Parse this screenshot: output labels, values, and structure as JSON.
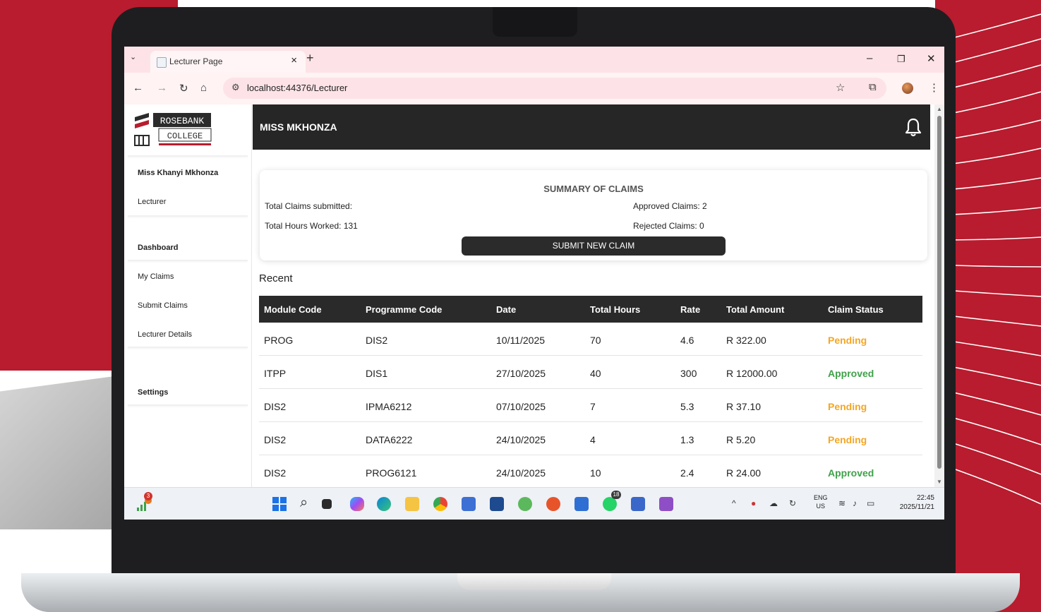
{
  "browser": {
    "tab_title": "Lecturer Page",
    "url": "localhost:44376/Lecturer"
  },
  "logo": {
    "line1": "ROSEBANK",
    "line2": "COLLEGE",
    "mark": "IIE"
  },
  "sidebar": {
    "user_name": "Miss Khanyi Mkhonza",
    "role": "Lecturer",
    "items": [
      {
        "label": "Dashboard"
      },
      {
        "label": "My Claims"
      },
      {
        "label": "Submit Claims"
      },
      {
        "label": "Lecturer Details"
      },
      {
        "label": "Settings"
      }
    ]
  },
  "header": {
    "title": "MISS MKHONZA"
  },
  "summary": {
    "title": "SUMMARY OF CLAIMS",
    "total_claims": "Total Claims submitted:",
    "total_hours": "Total Hours Worked: 131",
    "approved": "Approved Claims: 2",
    "rejected": "Rejected Claims: 0",
    "button": "SUBMIT NEW CLAIM"
  },
  "recent": {
    "heading": "Recent",
    "columns": [
      "Module Code",
      "Programme Code",
      "Date",
      "Total Hours",
      "Rate",
      "Total Amount",
      "Claim Status"
    ],
    "rows": [
      [
        "PROG",
        "DIS2",
        "10/11/2025",
        "70",
        "4.6",
        "R 322.00",
        "Pending"
      ],
      [
        "ITPP",
        "DIS1",
        "27/10/2025",
        "40",
        "300",
        "R 12000.00",
        "Approved"
      ],
      [
        "DIS2",
        "IPMA6212",
        "07/10/2025",
        "7",
        "5.3",
        "R 37.10",
        "Pending"
      ],
      [
        "DIS2",
        "DATA6222",
        "24/10/2025",
        "4",
        "1.3",
        "R 5.20",
        "Pending"
      ],
      [
        "DIS2",
        "PROG6121",
        "24/10/2025",
        "10",
        "2.4",
        "R 24.00",
        "Approved"
      ]
    ]
  },
  "taskbar": {
    "notification_count": "3",
    "whatsapp_badge": "18",
    "language": "ENG",
    "region": "US",
    "time": "22:45",
    "date": "2025/11/21"
  },
  "colors": {
    "brand_red": "#b81c2e",
    "header_dark": "#262626",
    "pending": "#f5a623",
    "approved": "#3fa14a"
  }
}
